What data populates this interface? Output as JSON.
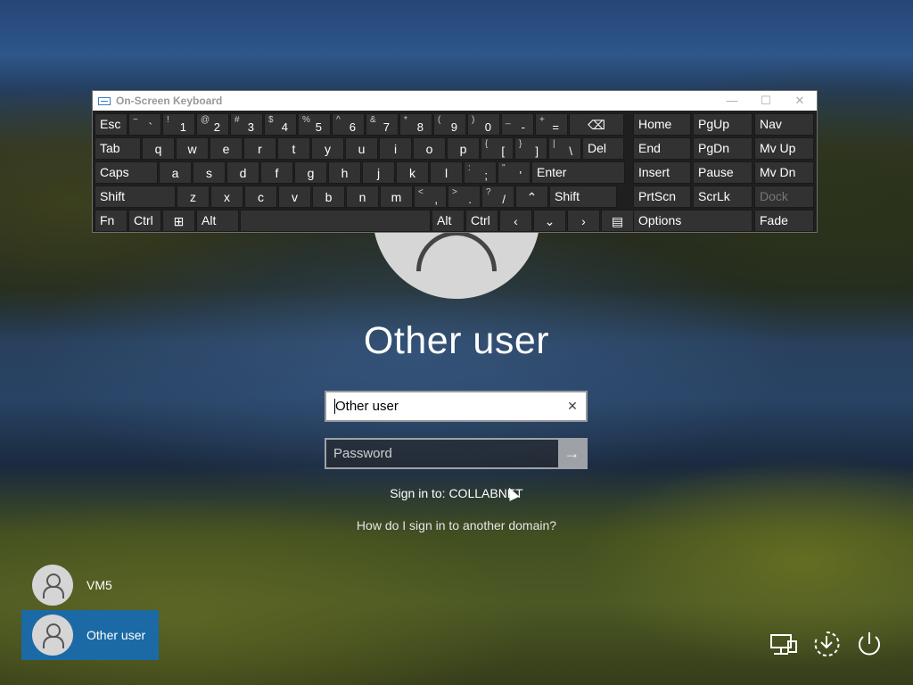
{
  "osk": {
    "title": "On-Screen Keyboard",
    "rows": [
      [
        {
          "main": "Esc"
        },
        {
          "shift": "~",
          "main": "`"
        },
        {
          "shift": "!",
          "main": "1"
        },
        {
          "shift": "@",
          "main": "2"
        },
        {
          "shift": "#",
          "main": "3"
        },
        {
          "shift": "$",
          "main": "4"
        },
        {
          "shift": "%",
          "main": "5"
        },
        {
          "shift": "^",
          "main": "6"
        },
        {
          "shift": "&",
          "main": "7"
        },
        {
          "shift": "*",
          "main": "8"
        },
        {
          "shift": "(",
          "main": "9"
        },
        {
          "shift": ")",
          "main": "0"
        },
        {
          "shift": "_",
          "main": "-"
        },
        {
          "shift": "+",
          "main": "="
        },
        {
          "main": "⌫"
        }
      ],
      [
        {
          "main": "Tab"
        },
        {
          "main": "q"
        },
        {
          "main": "w"
        },
        {
          "main": "e"
        },
        {
          "main": "r"
        },
        {
          "main": "t"
        },
        {
          "main": "y"
        },
        {
          "main": "u"
        },
        {
          "main": "i"
        },
        {
          "main": "o"
        },
        {
          "main": "p"
        },
        {
          "shift": "{",
          "main": "["
        },
        {
          "shift": "}",
          "main": "]"
        },
        {
          "shift": "|",
          "main": "\\"
        },
        {
          "main": "Del"
        }
      ],
      [
        {
          "main": "Caps"
        },
        {
          "main": "a"
        },
        {
          "main": "s"
        },
        {
          "main": "d"
        },
        {
          "main": "f"
        },
        {
          "main": "g"
        },
        {
          "main": "h"
        },
        {
          "main": "j"
        },
        {
          "main": "k"
        },
        {
          "main": "l"
        },
        {
          "shift": ":",
          "main": ";"
        },
        {
          "shift": "\"",
          "main": "'"
        },
        {
          "main": "Enter"
        }
      ],
      [
        {
          "main": "Shift"
        },
        {
          "main": "z"
        },
        {
          "main": "x"
        },
        {
          "main": "c"
        },
        {
          "main": "v"
        },
        {
          "main": "b"
        },
        {
          "main": "n"
        },
        {
          "main": "m"
        },
        {
          "shift": "<",
          "main": ","
        },
        {
          "shift": ">",
          "main": "."
        },
        {
          "shift": "?",
          "main": "/"
        },
        {
          "main": "⌃"
        },
        {
          "main": "Shift"
        }
      ],
      [
        {
          "main": "Fn"
        },
        {
          "main": "Ctrl"
        },
        {
          "main": "⊞"
        },
        {
          "main": "Alt"
        },
        {
          "main": ""
        },
        {
          "main": "Alt"
        },
        {
          "main": "Ctrl"
        },
        {
          "main": "‹"
        },
        {
          "main": "⌄"
        },
        {
          "main": "›"
        },
        {
          "main": "▤"
        }
      ]
    ],
    "nav_rows": [
      [
        "Home",
        "PgUp",
        "Nav"
      ],
      [
        "End",
        "PgDn",
        "Mv Up"
      ],
      [
        "Insert",
        "Pause",
        "Mv Dn"
      ],
      [
        "PrtScn",
        "ScrLk",
        "Dock"
      ],
      [
        "Options",
        "Fade"
      ]
    ]
  },
  "login": {
    "user_display_name": "Other user",
    "username_value": "Other user",
    "password_placeholder": "Password",
    "sign_in_to": "Sign in to: COLLABNET",
    "help_link": "How do I sign in to another domain?"
  },
  "users": [
    {
      "name": "VM5",
      "selected": false
    },
    {
      "name": "Other user",
      "selected": true
    }
  ],
  "system_icons": [
    "network-icon",
    "accessibility-icon",
    "power-icon"
  ]
}
